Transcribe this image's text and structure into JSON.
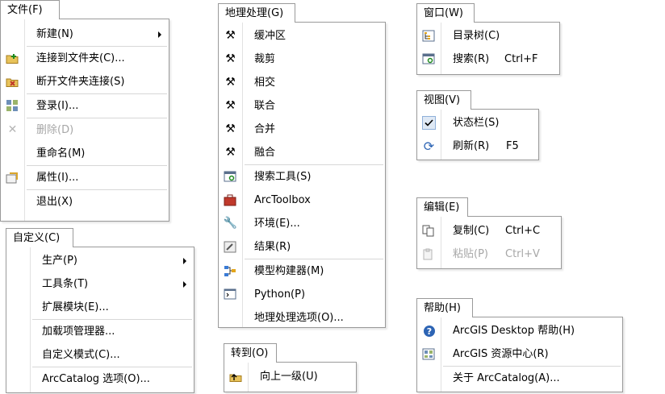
{
  "file_menu": {
    "header": "文件(F)",
    "items": {
      "new": "新建(N)",
      "connect": "连接到文件夹(C)...",
      "disconnect": "断开文件夹连接(S)",
      "login": "登录(I)...",
      "delete": "删除(D)",
      "rename": "重命名(M)",
      "properties": "属性(I)...",
      "exit": "退出(X)"
    }
  },
  "customize_menu": {
    "header": "自定义(C)",
    "items": {
      "production": "生产(P)",
      "toolbars": "工具条(T)",
      "extensions": "扩展模块(E)...",
      "addin_manager": "加载项管理器...",
      "customize_mode": "自定义模式(C)...",
      "arccatalog_options": "ArcCatalog 选项(O)..."
    }
  },
  "geoprocessing_menu": {
    "header": "地理处理(G)",
    "items": {
      "buffer": "缓冲区",
      "clip": "裁剪",
      "intersect": "相交",
      "union": "联合",
      "merge": "合并",
      "dissolve": "融合",
      "search_tools": "搜索工具(S)",
      "arctoolbox": "ArcToolbox",
      "environments": "环境(E)...",
      "results": "结果(R)",
      "model_builder": "模型构建器(M)",
      "python": "Python(P)",
      "gp_options": "地理处理选项(O)..."
    }
  },
  "goto_menu": {
    "header": "转到(O)",
    "items": {
      "up_one_level": "向上一级(U)"
    }
  },
  "window_menu": {
    "header": "窗口(W)",
    "items": {
      "catalog_tree": "目录树(C)",
      "search": "搜索(R)",
      "search_shortcut": "Ctrl+F"
    }
  },
  "view_menu": {
    "header": "视图(V)",
    "items": {
      "status_bar": "状态栏(S)",
      "refresh": "刷新(R)",
      "refresh_shortcut": "F5"
    }
  },
  "edit_menu": {
    "header": "编辑(E)",
    "items": {
      "copy": "复制(C)",
      "copy_shortcut": "Ctrl+C",
      "paste": "粘贴(P)",
      "paste_shortcut": "Ctrl+V"
    }
  },
  "help_menu": {
    "header": "帮助(H)",
    "items": {
      "desktop_help": "ArcGIS Desktop 帮助(H)",
      "resource_center": "ArcGIS 资源中心(R)",
      "about": "关于 ArcCatalog(A)..."
    }
  },
  "colors": {
    "menu_border": "#9a9a9a",
    "separator": "#d7d7d7",
    "disabled_text": "#a7a7a7",
    "icon_blue": "#2d64b4",
    "icon_red": "#c0392b"
  }
}
